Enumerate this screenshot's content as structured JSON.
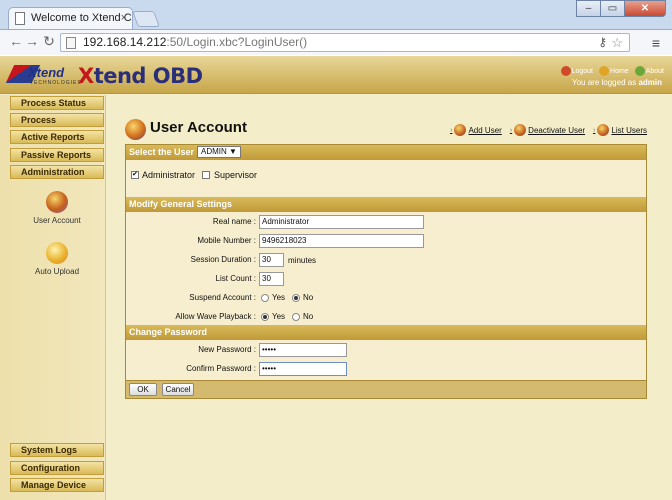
{
  "browser": {
    "tab_title": "Welcome to Xtend C",
    "tab_close": "×",
    "url_host": "192.168.14.212",
    "url_rest": ":50/Login.xbc?LoginUser()",
    "window_min": "–",
    "window_max": "▭",
    "window_close": "✕"
  },
  "header": {
    "brand": "Xtend",
    "brand_sub": "TECHNOLOGIES",
    "product_x": "X",
    "product_rest": "tend OBD",
    "links": [
      {
        "label": "Logout",
        "color": "#d04a2a"
      },
      {
        "label": "Home",
        "color": "#e0a526"
      },
      {
        "label": "About",
        "color": "#6aa83a"
      }
    ],
    "logged_prefix": "You are logged as",
    "logged_user": "admin"
  },
  "sidebar": {
    "top_items": [
      "Process Status",
      "Process",
      "Active Reports",
      "Passive Reports",
      "Administration"
    ],
    "tools": [
      {
        "label": "User Account",
        "color": "#8a5bb3"
      },
      {
        "label": "Auto Upload",
        "color": "#e07a2a"
      }
    ],
    "bottom_items": [
      "System Logs",
      "Configuration",
      "Manage Device"
    ]
  },
  "content": {
    "title": "User Account",
    "top_links": [
      "Add User",
      "Deactivate User",
      "List Users"
    ],
    "select_user_label": "Select the User",
    "select_user_value": "ADMIN ▼",
    "roles": [
      {
        "label": "Administrator",
        "checked": true
      },
      {
        "label": "Supervisor",
        "checked": false
      }
    ],
    "general_title": "Modify General Settings",
    "fields": {
      "real_name_label": "Real name :",
      "real_name_value": "Administrator",
      "mobile_label": "Mobile Number :",
      "mobile_value": "9496218023",
      "session_label": "Session Duration :",
      "session_value": "30",
      "session_unit": "minutes",
      "list_count_label": "List Count :",
      "list_count_value": "30",
      "suspend_label": "Suspend Account :",
      "suspend_value": "No",
      "wave_label": "Allow Wave Playback :",
      "wave_value": "Yes",
      "yes": "Yes",
      "no": "No"
    },
    "password_title": "Change Password",
    "new_password_label": "New Password :",
    "new_password_value": "•••••",
    "confirm_password_label": "Confirm Password :",
    "confirm_password_value": "•••••",
    "ok_label": "OK",
    "cancel_label": "Cancel"
  }
}
